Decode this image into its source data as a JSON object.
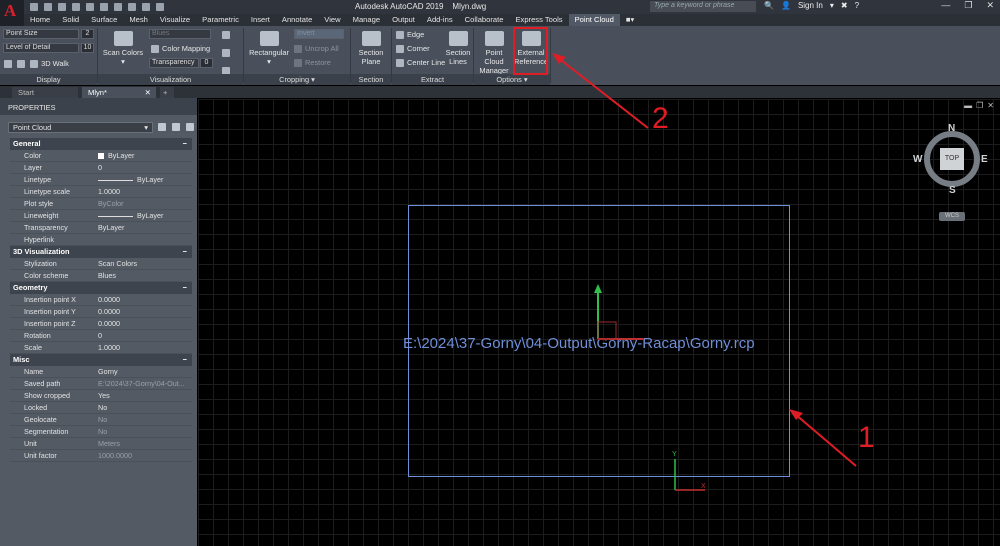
{
  "app": {
    "logo_letter": "A",
    "title": "Autodesk AutoCAD 2019",
    "file": "Mlyn.dwg",
    "search_placeholder": "Type a keyword or phrase",
    "signin": "Sign In"
  },
  "tabs": [
    "Home",
    "Solid",
    "Surface",
    "Mesh",
    "Visualize",
    "Parametric",
    "Insert",
    "Annotate",
    "View",
    "Manage",
    "Output",
    "Add-ins",
    "Collaborate",
    "Express Tools",
    "Point Cloud"
  ],
  "active_tab": "Point Cloud",
  "ribbon": {
    "display": {
      "label": "Display",
      "point_size_label": "Point Size",
      "point_size_value": "2",
      "lod_label": "Level of Detail",
      "lod_value": "10",
      "walk_label": "3D Walk"
    },
    "visualization": {
      "label": "Visualization",
      "scan_colors": "Scan Colors",
      "colors_dropdown": "Blues",
      "color_mapping": "Color Mapping",
      "transparency": "Transparency",
      "transparency_value": "0"
    },
    "cropping": {
      "label": "Cropping",
      "rectangular": "Rectangular",
      "invert": "Invert",
      "uncrop_all": "Uncrop All",
      "restore": "Restore"
    },
    "section": {
      "label": "Section",
      "section_plane": "Section Plane"
    },
    "extract": {
      "label": "Extract",
      "edge": "Edge",
      "corner": "Corner",
      "center_line": "Center Line",
      "section_lines": "Section Lines"
    },
    "options": {
      "label": "Options",
      "manager": "Point Cloud Manager",
      "external_reference": "External Reference"
    }
  },
  "doc_tabs": [
    "Start",
    "Mlyn*"
  ],
  "properties": {
    "title": "PROPERTIES",
    "object_type": "Point Cloud",
    "sections": [
      {
        "name": "General",
        "rows": [
          {
            "key": "Color",
            "value": "ByLayer",
            "kind": "swatch"
          },
          {
            "key": "Layer",
            "value": "0"
          },
          {
            "key": "Linetype",
            "value": "ByLayer",
            "kind": "line"
          },
          {
            "key": "Linetype scale",
            "value": "1.0000"
          },
          {
            "key": "Plot style",
            "value": "ByColor",
            "dim": true
          },
          {
            "key": "Lineweight",
            "value": "ByLayer",
            "kind": "line"
          },
          {
            "key": "Transparency",
            "value": "ByLayer"
          },
          {
            "key": "Hyperlink",
            "value": ""
          }
        ]
      },
      {
        "name": "3D Visualization",
        "rows": [
          {
            "key": "Stylization",
            "value": "Scan Colors"
          },
          {
            "key": "Color scheme",
            "value": "Blues"
          }
        ]
      },
      {
        "name": "Geometry",
        "rows": [
          {
            "key": "Insertion point X",
            "value": "0.0000"
          },
          {
            "key": "Insertion point Y",
            "value": "0.0000"
          },
          {
            "key": "Insertion point Z",
            "value": "0.0000"
          },
          {
            "key": "Rotation",
            "value": "0"
          },
          {
            "key": "Scale",
            "value": "1.0000"
          }
        ]
      },
      {
        "name": "Misc",
        "rows": [
          {
            "key": "Name",
            "value": "Gorny"
          },
          {
            "key": "Saved path",
            "value": "E:\\2024\\37-Gorny\\04-Out...",
            "dim": true
          },
          {
            "key": "Show cropped",
            "value": "Yes"
          },
          {
            "key": "Locked",
            "value": "No"
          },
          {
            "key": "Geolocate",
            "value": "No",
            "dim": true
          },
          {
            "key": "Segmentation",
            "value": "No",
            "dim": true
          },
          {
            "key": "Unit",
            "value": "Meters",
            "dim": true
          },
          {
            "key": "Unit factor",
            "value": "1000.0000",
            "dim": true
          }
        ]
      }
    ]
  },
  "viewport": {
    "rcp_path": "E:\\2024\\37-Gorny\\04-Output\\Gorny-Racap\\Gorny.rcp",
    "viewcube": {
      "top": "TOP",
      "n": "N",
      "s": "S",
      "e": "E",
      "w": "W"
    },
    "wcs": "WCS"
  },
  "annotations": {
    "one": "1",
    "two": "2"
  },
  "colors": {
    "accent": "#e01d25",
    "rcp_blue": "#6f8fd8"
  }
}
